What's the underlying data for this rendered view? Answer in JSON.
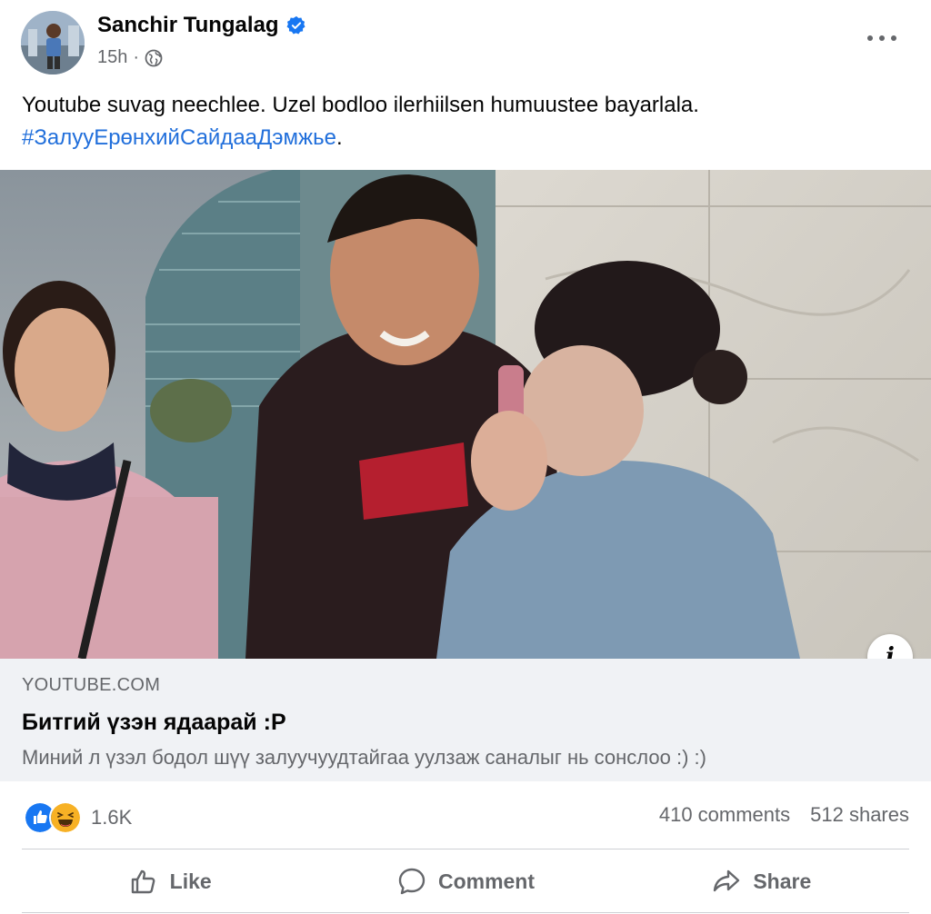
{
  "post": {
    "author_name": "Sanchir Tungalag",
    "timestamp": "15h",
    "separator": "·",
    "visibility_icon": "globe-icon",
    "verified_icon": "verified-badge-icon",
    "more_icon": "more-options-icon",
    "caption_text": "Youtube suvag neechlee. Uzel bodloo ilerhiilsen humuustee bayarlala.",
    "caption_hashtag": "#ЗалууЕрөнхийСайдааДэмжье",
    "caption_suffix": "."
  },
  "link_preview": {
    "domain": "YOUTUBE.COM",
    "title": "Битгий үзэн ядаарай :P",
    "description": "Миний л үзэл бодол шүү залуучуудтайгаа уулзаж саналыг нь сонслоо :) :)",
    "info_label": "i"
  },
  "stats": {
    "reaction_icons": [
      "like-reaction-icon",
      "haha-reaction-icon"
    ],
    "reaction_count": "1.6K",
    "comments": "410 comments",
    "shares": "512 shares"
  },
  "actions": {
    "like_label": "Like",
    "comment_label": "Comment",
    "share_label": "Share"
  },
  "colors": {
    "accent": "#1877f2",
    "hashtag": "#216fdb",
    "secondary_text": "#65676b",
    "link_card_bg": "#f0f2f5",
    "haha": "#f7b125"
  }
}
